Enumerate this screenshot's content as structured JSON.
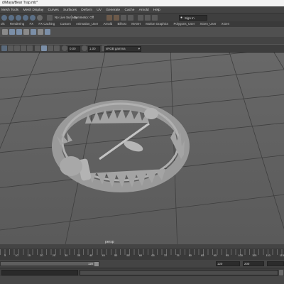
{
  "window": {
    "title": "d/Maya/Bear Trap.mb*"
  },
  "menu": [
    "Mesh Tools",
    "Mesh Display",
    "Curves",
    "Surfaces",
    "Deform",
    "UV",
    "Generate",
    "Cache",
    "Arnold",
    "Help"
  ],
  "status_line": {
    "surface_label": "No Live Surface",
    "symmetry_label": "Symmetry: Off",
    "signin_label": "Sign In"
  },
  "shelf_tabs": [
    "ols",
    "Rendering",
    "FX",
    "FX Caching",
    "Custom",
    "Animation_User",
    "Arnold",
    "Bifrost",
    "MASH",
    "Motion Graphics",
    "Polygons_User",
    "XGen_User",
    "XGen"
  ],
  "viewport": {
    "field_a": "0.00",
    "field_b": "1.00",
    "colorspace": "sRGB gamma",
    "camera_label": "persp"
  },
  "time_slider": {
    "ticks": [
      "5",
      "10",
      "15",
      "20",
      "25",
      "30",
      "35",
      "40",
      "45",
      "50",
      "55",
      "60",
      "65",
      "70",
      "75",
      "80",
      "85",
      "90",
      "95",
      "100",
      "105",
      "110",
      "115"
    ]
  },
  "range": {
    "start": "120",
    "end": "120",
    "max": "200"
  },
  "colors": {
    "menubar": "#444444",
    "viewport_bg": "#626262",
    "grid_line": "#3e3e3e",
    "model": "#9c9c9c"
  }
}
